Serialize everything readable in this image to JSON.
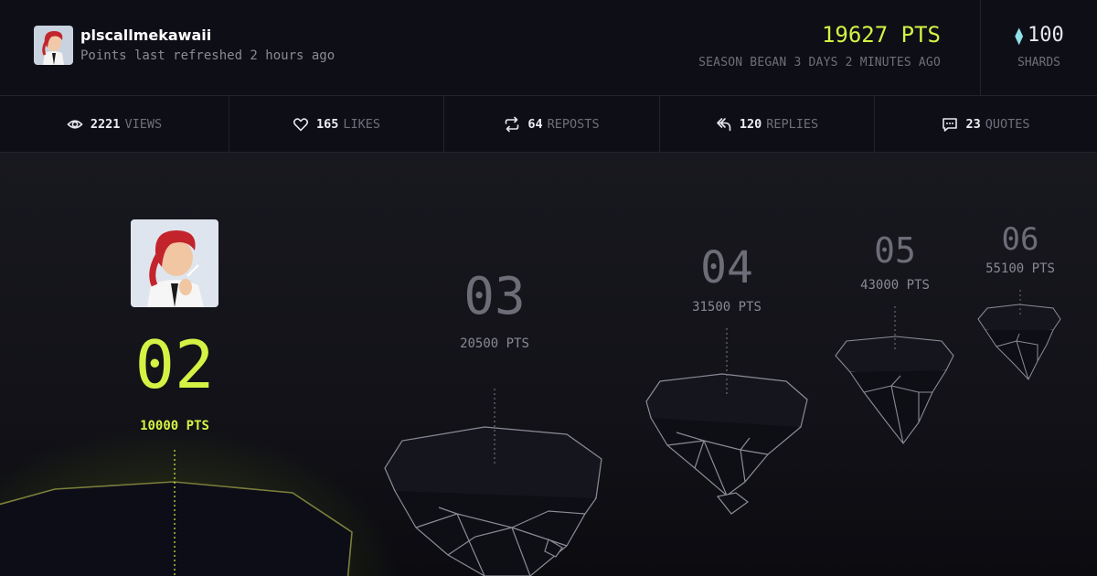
{
  "header": {
    "username": "plscallmekawaii",
    "refreshed": "Points last refreshed 2 hours ago",
    "points_total": "19627 PTS",
    "season": "SEASON BEGAN 3 DAYS 2 MINUTES AGO",
    "shards_value": "100",
    "shards_label": "SHARDS"
  },
  "stats": [
    {
      "icon": "eye-icon",
      "value": "2221",
      "label": "VIEWS"
    },
    {
      "icon": "heart-icon",
      "value": "165",
      "label": "LIKES"
    },
    {
      "icon": "repost-icon",
      "value": "64",
      "label": "REPOSTS"
    },
    {
      "icon": "reply-icon",
      "value": "120",
      "label": "REPLIES"
    },
    {
      "icon": "quote-icon",
      "value": "23",
      "label": "QUOTES"
    }
  ],
  "tiers": [
    {
      "number": "02",
      "points": "10000 PTS",
      "current": true
    },
    {
      "number": "03",
      "points": "20500 PTS"
    },
    {
      "number": "04",
      "points": "31500 PTS"
    },
    {
      "number": "05",
      "points": "43000 PTS"
    },
    {
      "number": "06",
      "points": "55100 PTS"
    }
  ],
  "colors": {
    "accent": "#d4f244",
    "background": "#0c0c14",
    "gem": "#8fe0e8"
  }
}
